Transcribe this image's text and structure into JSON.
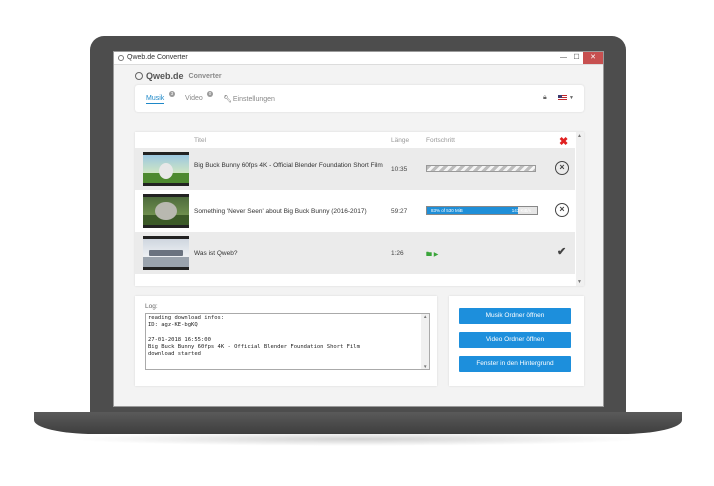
{
  "window": {
    "title": "Qweb.de Converter",
    "minimize": "—",
    "maximize": "☐",
    "close": "✕"
  },
  "brand": {
    "name": "Qweb.de",
    "sub": "Converter"
  },
  "tabs": [
    {
      "label": "Musik",
      "count": "3"
    },
    {
      "label": "Video",
      "count": "0"
    },
    {
      "label": "Einstellungen"
    }
  ],
  "table": {
    "headers": {
      "title": "Titel",
      "length": "Länge",
      "progress": "Fortschritt"
    },
    "rows": [
      {
        "title": "Big Buck Bunny 60fps 4K - Official Blender Foundation Short Film",
        "length": "10:35",
        "status": "queued"
      },
      {
        "title": "Something 'Never Seen' about Big Buck Bunny (2016-2017)",
        "length": "59:27",
        "status": "downloading",
        "progress_left": "83% of 530 MiB",
        "progress_right": "143 KiB/s",
        "progress_fraction": 0.83
      },
      {
        "title": "Was ist Qweb?",
        "length": "1:26",
        "status": "done"
      }
    ]
  },
  "log": {
    "label": "Log:",
    "text": "reading download infos:\nID: agz-KE-bgKQ\n\n27-01-2018 16:55:00\nBig Buck Bunny 60fps 4K - Official Blender Foundation Short Film\ndownload started"
  },
  "buttons": {
    "music_folder": "Musik Ordner öffnen",
    "video_folder": "Video Ordner öffnen",
    "background": "Fenster in den Hintergrund"
  },
  "colors": {
    "accent": "#1d8fdc",
    "remove_all": "#e02020",
    "success": "#3aa53a"
  }
}
